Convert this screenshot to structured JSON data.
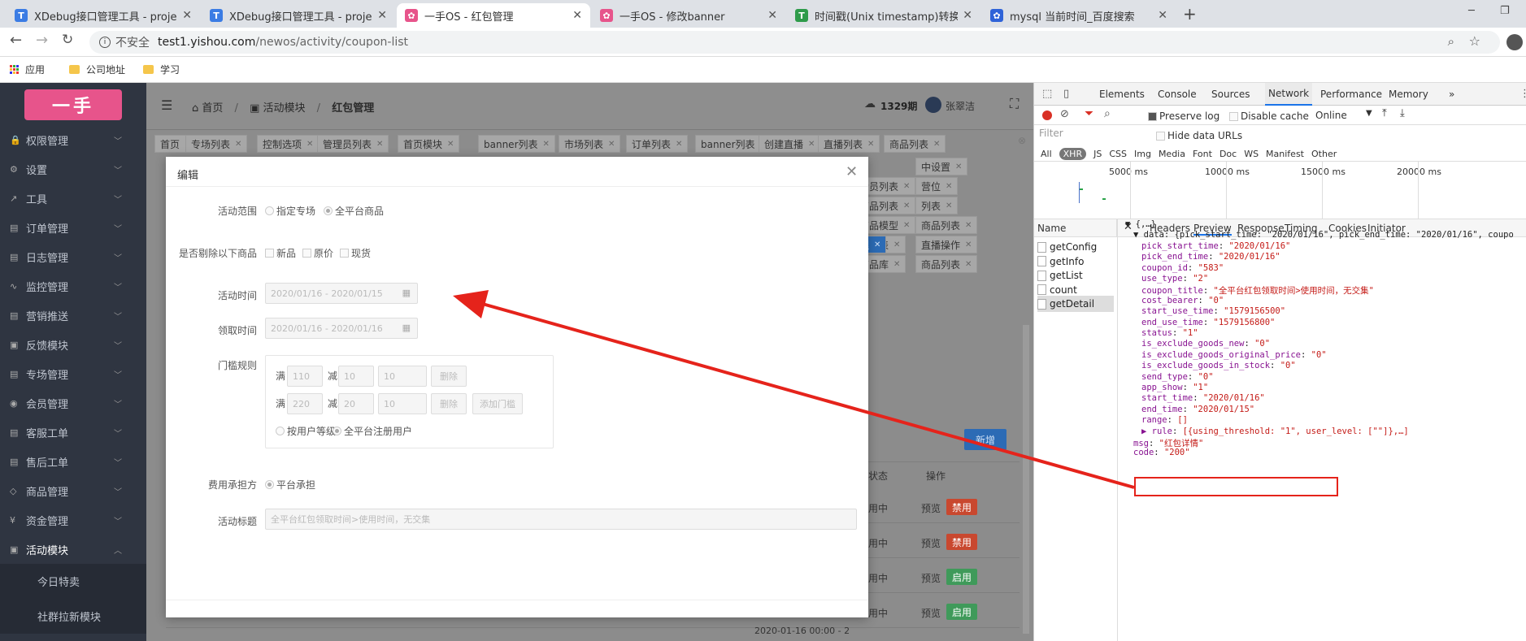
{
  "browser": {
    "tabs": [
      {
        "title": "XDebug接口管理工具 - project",
        "favicon": "T",
        "color": "#3b7ce4",
        "active": false
      },
      {
        "title": "XDebug接口管理工具 - project",
        "favicon": "T",
        "color": "#3b7ce4",
        "active": false
      },
      {
        "title": "一手OS - 红包管理",
        "favicon": "✿",
        "color": "#e7548b",
        "active": true
      },
      {
        "title": "一手OS - 修改banner",
        "favicon": "✿",
        "color": "#e7548b",
        "active": false
      },
      {
        "title": "时间戳(Unix timestamp)转换工具",
        "favicon": "T",
        "color": "#2e9b4a",
        "active": false
      },
      {
        "title": "mysql 当前时间_百度搜索",
        "favicon": "✿",
        "color": "#2f63d8",
        "active": false
      }
    ],
    "new_tab": "+",
    "security": "不安全",
    "url_host": "test1.yishou.com",
    "url_path": "/newos/activity/coupon-list",
    "bookmarks": [
      "应用",
      "公司地址",
      "学习"
    ]
  },
  "sidebar": {
    "logo": "一手",
    "menus": [
      "权限管理",
      "设置",
      "工具",
      "订单管理",
      "日志管理",
      "监控管理",
      "营销推送",
      "反馈模块",
      "专场管理",
      "会员管理",
      "客服工单",
      "售后工单",
      "商品管理",
      "资金管理",
      "活动模块"
    ],
    "submenus": [
      "今日特卖",
      "社群拉新模块"
    ]
  },
  "topbar": {
    "crumbs": [
      "首页",
      "活动模块",
      "红包管理"
    ],
    "period": "1329期",
    "user": "张翠洁",
    "new_button": "新增"
  },
  "page_tabs": {
    "row1": [
      "首页",
      "专场列表",
      "控制选项",
      "管理员列表",
      "首页模块",
      "banner列表",
      "市场列表",
      "订单列表",
      "banner列表",
      "创建直播",
      "直播列表",
      "商品列表"
    ],
    "right_col": [
      "中设置",
      "会员列表",
      "营位",
      "商品列表",
      "列表",
      "商品模型",
      "商品列表",
      "品列表",
      "直播操作",
      "商品库",
      "商品列表"
    ],
    "active_partial": "理"
  },
  "table": {
    "headers": [
      "状态",
      "操作"
    ],
    "rows": [
      {
        "status": "用中",
        "preview": "预览",
        "action": "禁用",
        "color": "#c9482f"
      },
      {
        "status": "用中",
        "preview": "预览",
        "action": "禁用",
        "color": "#c9482f"
      },
      {
        "status": "用中",
        "preview": "预览",
        "action": "启用",
        "color": "#3f9a5a"
      },
      {
        "status": "用中",
        "preview": "预览",
        "action": "启用",
        "color": "#3f9a5a"
      }
    ],
    "date_text": "2020-01-16 00:00 - 2"
  },
  "modal": {
    "title": "编辑",
    "scope_label": "活动范围",
    "scope_options": [
      "指定专场",
      "全平台商品"
    ],
    "exclude_label": "是否剔除以下商品",
    "exclude_options": [
      "新品",
      "原价",
      "现货"
    ],
    "activity_time_label": "活动时间",
    "activity_time_value": "2020/01/16 - 2020/01/15",
    "receive_time_label": "领取时间",
    "receive_time_value": "2020/01/16 - 2020/01/16",
    "threshold_label": "门槛规则",
    "rules": [
      {
        "full": "满",
        "amount": "110",
        "minus": "减",
        "discount": "10",
        "count": "10",
        "delete": "删除"
      },
      {
        "full": "满",
        "amount": "220",
        "minus": "减",
        "discount": "20",
        "count": "10",
        "delete": "删除",
        "add": "添加门槛"
      }
    ],
    "user_options": [
      "按用户等级",
      "全平台注册用户"
    ],
    "cost_label": "费用承担方",
    "cost_option": "平台承担",
    "title_label": "活动标题",
    "title_value": "全平台红包领取时间>使用时间，无交集"
  },
  "devtools": {
    "tabs": [
      "Elements",
      "Console",
      "Sources",
      "Network",
      "Performance",
      "Memory",
      "»"
    ],
    "preserve_log": "Preserve log",
    "disable_cache": "Disable cache",
    "online": "Online",
    "filter_placeholder": "Filter",
    "hide_data_urls": "Hide data URLs",
    "types": [
      "All",
      "XHR",
      "JS",
      "CSS",
      "Img",
      "Media",
      "Font",
      "Doc",
      "WS",
      "Manifest",
      "Other"
    ],
    "timeline": [
      "5000 ms",
      "10000 ms",
      "15000 ms",
      "20000 ms"
    ],
    "name_header": "Name",
    "requests": [
      "getConfig",
      "getInfo",
      "getList",
      "count",
      "getDetail"
    ],
    "detail_tabs": [
      "Headers",
      "Preview",
      "Response",
      "Timing",
      "Cookies",
      "Initiator"
    ],
    "preview_lines": [
      {
        "indent": 0,
        "text": "▼ {,…}"
      },
      {
        "indent": 1,
        "text": "▼ data: {pick_start_time: \"2020/01/16\", pick_end_time: \"2020/01/16\", coupo"
      },
      {
        "indent": 2,
        "key": "pick_start_time",
        "val": "\"2020/01/16\""
      },
      {
        "indent": 2,
        "key": "pick_end_time",
        "val": "\"2020/01/16\""
      },
      {
        "indent": 2,
        "key": "coupon_id",
        "val": "\"583\""
      },
      {
        "indent": 2,
        "key": "use_type",
        "val": "\"2\""
      },
      {
        "indent": 2,
        "key": "coupon_title",
        "val": "\"全平台红包领取时间>使用时间，无交集\""
      },
      {
        "indent": 2,
        "key": "cost_bearer",
        "val": "\"0\""
      },
      {
        "indent": 2,
        "key": "start_use_time",
        "val": "\"1579156500\""
      },
      {
        "indent": 2,
        "key": "end_use_time",
        "val": "\"1579156800\""
      },
      {
        "indent": 2,
        "key": "status",
        "val": "\"1\""
      },
      {
        "indent": 2,
        "key": "is_exclude_goods_new",
        "val": "\"0\""
      },
      {
        "indent": 2,
        "key": "is_exclude_goods_original_price",
        "val": "\"0\""
      },
      {
        "indent": 2,
        "key": "is_exclude_goods_in_stock",
        "val": "\"0\""
      },
      {
        "indent": 2,
        "key": "send_type",
        "val": "\"0\""
      },
      {
        "indent": 2,
        "key": "app_show",
        "val": "\"1\""
      },
      {
        "indent": 2,
        "key": "start_time",
        "val": "\"2020/01/16\""
      },
      {
        "indent": 2,
        "key": "end_time",
        "val": "\"2020/01/15\""
      },
      {
        "indent": 2,
        "key": "range",
        "val": "[]"
      },
      {
        "indent": 2,
        "key": "▶ rule",
        "val": "[{using_threshold: \"1\", user_level: [\"\"]},…]"
      },
      {
        "indent": 1,
        "key": "msg",
        "val": "\"红包详情\""
      },
      {
        "indent": 1,
        "key": "code",
        "val": "\"200\""
      }
    ]
  },
  "annotation_color": "#e5231b"
}
